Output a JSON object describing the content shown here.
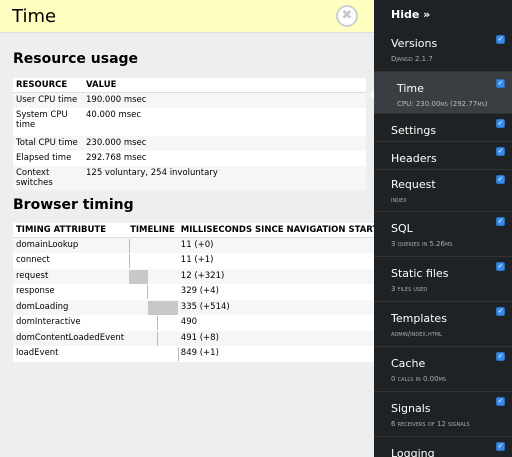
{
  "panel": {
    "title": "Time",
    "close_glyph": "✖"
  },
  "resource_usage": {
    "title": "Resource usage",
    "headers": [
      "RESOURCE",
      "VALUE"
    ],
    "rows": [
      {
        "resource": "User CPU time",
        "value": "190.000 msec"
      },
      {
        "resource": "System CPU time",
        "value": "40.000 msec"
      },
      {
        "resource": "Total CPU time",
        "value": "230.000 msec"
      },
      {
        "resource": "Elapsed time",
        "value": "292.768 msec"
      },
      {
        "resource": "Context switches",
        "value": "125 voluntary, 254 involuntary"
      }
    ]
  },
  "browser_timing": {
    "title": "Browser timing",
    "headers": [
      "TIMING ATTRIBUTE",
      "TIMELINE",
      "MILLISECONDS SINCE NAVIGATION START"
    ],
    "rows": [
      {
        "attr": "domainLookup",
        "ms": "11 (+0)"
      },
      {
        "attr": "connect",
        "ms": "11 (+1)"
      },
      {
        "attr": "request",
        "ms": "12 (+321)"
      },
      {
        "attr": "response",
        "ms": "329 (+4)"
      },
      {
        "attr": "domLoading",
        "ms": "335 (+514)"
      },
      {
        "attr": "domInteractive",
        "ms": "490"
      },
      {
        "attr": "domContentLoadedEvent",
        "ms": "491 (+8)"
      },
      {
        "attr": "loadEvent",
        "ms": "849 (+1)"
      }
    ]
  },
  "toolbar": {
    "hide_label": "Hide »",
    "items": [
      {
        "label": "Versions",
        "sub": "Django 2.1.7",
        "checked": true
      },
      {
        "label": "Time",
        "sub": "CPU: 230.00ms (292.77ms)",
        "checked": true
      },
      {
        "label": "Settings",
        "sub": "",
        "checked": true
      },
      {
        "label": "Headers",
        "sub": "",
        "checked": true
      },
      {
        "label": "Request",
        "sub": "index",
        "checked": true
      },
      {
        "label": "SQL",
        "sub": "3 queries in 5.26ms",
        "checked": true
      },
      {
        "label": "Static files",
        "sub": "3 files used",
        "checked": true
      },
      {
        "label": "Templates",
        "sub": "admin/index.html",
        "checked": true
      },
      {
        "label": "Cache",
        "sub": "0 calls in 0.00ms",
        "checked": true
      },
      {
        "label": "Signals",
        "sub": "6 receivers of 12 signals",
        "checked": true
      },
      {
        "label": "Logging",
        "sub": "",
        "checked": true
      }
    ],
    "check_glyph": "✓"
  },
  "colors": {
    "toolbar_bg": "#1f2224",
    "active_item_bg": "#3a3e42",
    "header_bg": "#ffffc2",
    "checkbox": "#3b8ae6"
  }
}
